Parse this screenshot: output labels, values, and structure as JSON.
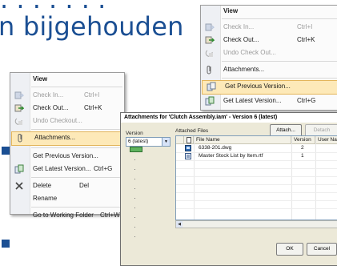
{
  "slide": {
    "heading_visible": "n bijgehouden"
  },
  "menu_small": {
    "header": "View",
    "items": [
      {
        "label": "Check In...",
        "shortcut": "Ctrl+I",
        "disabled": true
      },
      {
        "label": "Check Out...",
        "shortcut": "Ctrl+K",
        "disabled": false
      },
      {
        "label": "Undo Check Out...",
        "shortcut": "",
        "disabled": true
      },
      {
        "label": "Attachments...",
        "shortcut": "",
        "disabled": false
      },
      {
        "label": "Get Previous Version...",
        "shortcut": "",
        "disabled": false,
        "highlighted": true
      },
      {
        "label": "Get Latest Version...",
        "shortcut": "Ctrl+G",
        "disabled": false
      }
    ]
  },
  "menu_large": {
    "header": "View",
    "items": [
      {
        "label": "Check In...",
        "shortcut": "Ctrl+I",
        "disabled": true
      },
      {
        "label": "Check Out...",
        "shortcut": "Ctrl+K",
        "disabled": false
      },
      {
        "label": "Undo Checkout...",
        "shortcut": "",
        "disabled": true
      },
      {
        "label": "Attachments...",
        "shortcut": "",
        "disabled": false,
        "highlighted": true
      },
      {
        "label": "Get Previous Version...",
        "shortcut": "",
        "disabled": false
      },
      {
        "label": "Get Latest Version...",
        "shortcut": "Ctrl+G",
        "disabled": false
      },
      {
        "label": "Delete",
        "shortcut": "Del",
        "disabled": false
      },
      {
        "label": "Rename",
        "shortcut": "",
        "disabled": false
      },
      {
        "label": "Go to Working Folder",
        "shortcut": "Ctrl+W",
        "disabled": false
      }
    ]
  },
  "dialog": {
    "title": "Attachments for 'Clutch Assembly.iam' - Version 6 (latest)",
    "version_label": "Version",
    "version_value": "6 (latest)",
    "attached_label": "Attached Files",
    "attach_button": "Attach...",
    "detach_button": "Detach",
    "columns": [
      "File Name",
      "Version",
      "User Name"
    ],
    "rows": [
      {
        "name": "6338-201.dwg",
        "version": "2"
      },
      {
        "name": "Master Stock List by Item.rtf",
        "version": "1"
      }
    ],
    "ok_button": "OK",
    "cancel_button": "Cancel"
  }
}
